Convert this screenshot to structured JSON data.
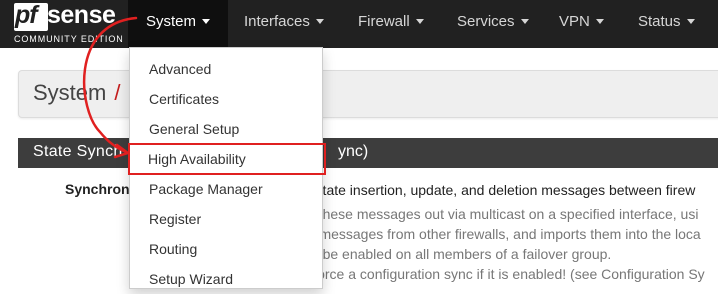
{
  "brand": {
    "logo_pf": "pf",
    "logo_sense": "sense",
    "edition": "COMMUNITY EDITION"
  },
  "navbar": {
    "items": [
      {
        "label": "System",
        "active": true
      },
      {
        "label": "Interfaces"
      },
      {
        "label": "Firewall"
      },
      {
        "label": "Services"
      },
      {
        "label": "VPN"
      },
      {
        "label": "Status"
      }
    ]
  },
  "dropdown": {
    "items": [
      {
        "label": "Advanced"
      },
      {
        "label": "Certificates"
      },
      {
        "label": "General Setup"
      },
      {
        "label": "High Availability",
        "highlighted": true
      },
      {
        "label": "Package Manager"
      },
      {
        "label": "Register"
      },
      {
        "label": "Routing"
      },
      {
        "label": "Setup Wizard"
      }
    ]
  },
  "page": {
    "title": "System",
    "breadcrumb_sep": "/"
  },
  "panel": {
    "title": "State Synch",
    "title_tail": "ync)",
    "field_label": "Synchroni",
    "help_lines": [
      "rs state insertion, update, and deletion messages between firew",
      "ds these messages out via multicast on a specified interface, usi",
      "lar messages from other firewalls, and imports them into the loca",
      "uld be enabled on all members of a failover group.",
      "ill force a configuration sync if it is enabled! (see Configuration Sy"
    ]
  },
  "colors": {
    "navbar_bg": "#212121",
    "annotation": "#e02020",
    "breadcrumb_accent": "#c41e1e"
  }
}
